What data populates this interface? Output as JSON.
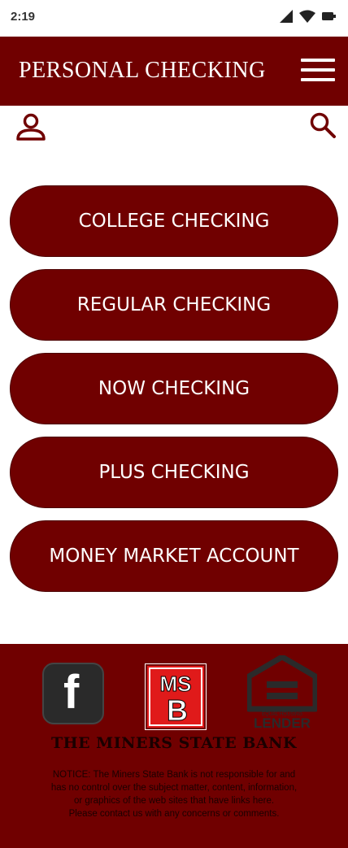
{
  "status_bar": {
    "time": "2:19",
    "icons": [
      "signal-icon",
      "wifi-icon",
      "battery-icon"
    ]
  },
  "header": {
    "title": "PERSONAL CHECKING",
    "menu_icon": "hamburger-menu-icon"
  },
  "toolbar": {
    "profile_icon": "user-profile-icon",
    "search_icon": "search-icon"
  },
  "accounts": [
    {
      "label": "COLLEGE CHECKING"
    },
    {
      "label": "REGULAR CHECKING"
    },
    {
      "label": "NOW CHECKING"
    },
    {
      "label": "PLUS CHECKING"
    },
    {
      "label": "MONEY MARKET ACCOUNT"
    }
  ],
  "footer": {
    "facebook_letter": "f",
    "msb_logo_letters": "MSB",
    "equal_housing_text": "EQUAL HOUSING LENDER",
    "bank_name": "THE MINERS STATE BANK",
    "notice_lines": [
      "NOTICE: The Miners State Bank is not responsible for and",
      "has no control over the subject matter, content, information,",
      "or graphics of the web sites that have links here.",
      "Please contact us with any concerns or comments."
    ]
  },
  "colors": {
    "brand": "#700000",
    "text_light": "#ffffff",
    "text_dark": "#1a0000"
  }
}
